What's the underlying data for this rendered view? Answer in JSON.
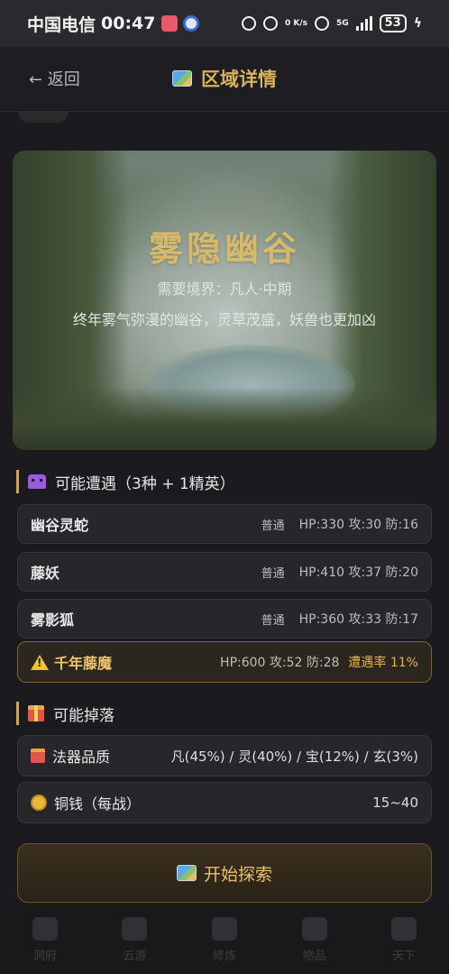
{
  "status_bar": {
    "carrier": "中国电信",
    "time": "00:47",
    "net_speed": "0 K/s",
    "network": "5G",
    "battery": "53"
  },
  "header": {
    "back_label": "← 返回",
    "title": "区域详情",
    "title_icon": "map-icon"
  },
  "hero": {
    "name": "雾隐幽谷",
    "requirement": "需要境界：凡人·中期",
    "description": "终年雾气弥漫的幽谷，灵草茂盛，妖兽也更加凶"
  },
  "encounters": {
    "title": "可能遭遇（3种 + 1精英）",
    "monsters": [
      {
        "name": "幽谷灵蛇",
        "tier": "普通",
        "stats": "HP:330 攻:30 防:16"
      },
      {
        "name": "藤妖",
        "tier": "普通",
        "stats": "HP:410 攻:37 防:20"
      },
      {
        "name": "雾影狐",
        "tier": "普通",
        "stats": "HP:360 攻:33 防:17"
      }
    ],
    "elite": {
      "name": "千年藤魔",
      "stats": "HP:600 攻:52 防:28",
      "rate": "遭遇率 11%"
    }
  },
  "drops": {
    "title": "可能掉落",
    "items": [
      {
        "label": "法器品质",
        "value": "凡(45%) / 灵(40%) / 宝(12%) / 玄(3%)"
      },
      {
        "label": "铜钱（每战）",
        "value": "15~40"
      }
    ]
  },
  "explore_button": "开始探索",
  "bottom_nav": [
    "洞府",
    "云游",
    "修炼",
    "物品",
    "天下"
  ]
}
